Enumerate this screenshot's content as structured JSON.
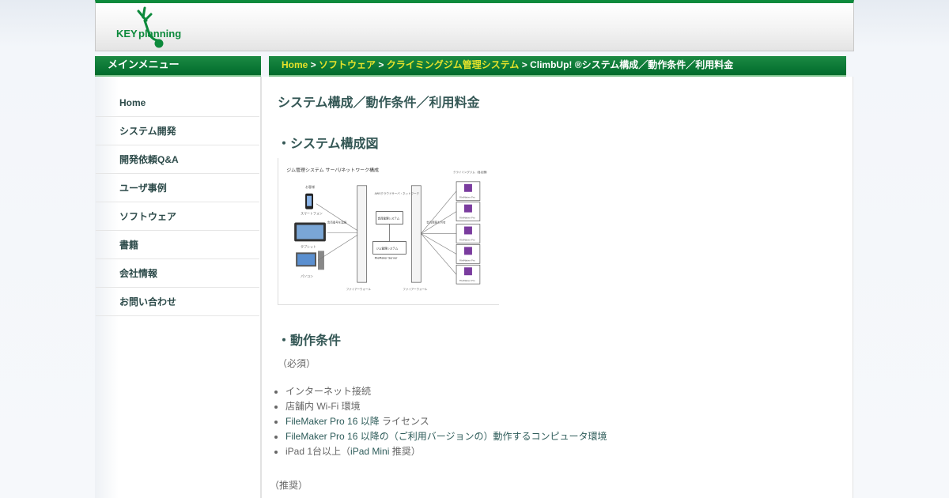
{
  "header": {
    "logo_text_key": "KEY",
    "logo_text_planning": "planning"
  },
  "sidebar": {
    "title": "メインメニュー",
    "items": [
      {
        "label": "Home"
      },
      {
        "label": "システム開発"
      },
      {
        "label": "開発依頼Q&A"
      },
      {
        "label": "ユーザ事例"
      },
      {
        "label": "ソフトウェア"
      },
      {
        "label": "書籍"
      },
      {
        "label": "会社情報"
      },
      {
        "label": "お問い合わせ"
      }
    ]
  },
  "breadcrumb": {
    "home": "Home",
    "sep": " > ",
    "software": "ソフトウェア",
    "gym": "クライミングジム管理システム",
    "current": "ClimbUp! ®システム構成／動作条件／利用料金"
  },
  "main": {
    "title": "システム構成／動作条件／利用料金",
    "section_system": "・システム構成図",
    "section_requirements": "・動作条件",
    "required_label": "（必須）",
    "requirements": [
      {
        "plain": "インターネット接続",
        "link": "",
        "tail": ""
      },
      {
        "plain": "店舗内 Wi-Fi 環境",
        "link": "",
        "tail": ""
      },
      {
        "plain": "",
        "link": "FileMaker Pro 16 以降",
        "tail": " ライセンス"
      },
      {
        "plain": "",
        "link": "FileMaker Pro 16 以降の（ご利用バージョンの）動作するコンピュータ環境",
        "tail": ""
      },
      {
        "plain": "iPad 1台以上（",
        "link": "iPad Mini",
        "tail": " 推奨）"
      }
    ],
    "recommended_label": "（推奨）"
  },
  "diagram": {
    "title": "ジム管理システム サーバ/ネットワーク構成",
    "left_labels": [
      "お客様",
      "スマートフォン",
      "タブレット",
      "パソコン"
    ],
    "arrow_label_left": "会員番号を連絡",
    "center_top": "AWSクラウドサーバ・ネットワーク",
    "box_top": "会員管理システム",
    "box_bottom": "ジム管理システム",
    "server_label": "FileMaker Server",
    "firewall": "ファイアーウォール",
    "arrow_label_right": "会員情報を共有",
    "right_title": "クライミングジム（各店舗）",
    "right_app": "FileMaker Pro",
    "colors": {
      "accent": "#0d8a3c",
      "link": "#e5e22a"
    }
  }
}
